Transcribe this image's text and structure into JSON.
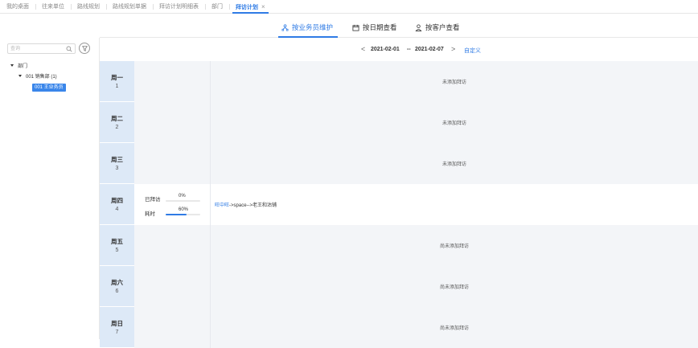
{
  "top_tabs": [
    {
      "label": "我的桌面"
    },
    {
      "label": "往来单位"
    },
    {
      "label": "路线规划"
    },
    {
      "label": "路线规划单据"
    },
    {
      "label": "拜访计划明细表"
    },
    {
      "label": "部门"
    },
    {
      "label": "拜访计划",
      "active": true,
      "close": "×"
    }
  ],
  "sidebar": {
    "search_placeholder": "查询",
    "tree": {
      "root": "部门",
      "child": "001 销售部 (1)",
      "leaf": "001 王业务员"
    }
  },
  "view_tabs": {
    "by_salesman": "按业务员维护",
    "by_date": "按日期查看",
    "by_customer": "按客户查看"
  },
  "date_range": {
    "prev": "<",
    "start": "2021-02-01",
    "sep": "--",
    "end": "2021-02-07",
    "next": ">",
    "custom": "自定义"
  },
  "days": [
    {
      "name": "周一",
      "num": "1",
      "content": "未添加拜访"
    },
    {
      "name": "周二",
      "num": "2",
      "content": "未添加拜访"
    },
    {
      "name": "周三",
      "num": "3",
      "content": "未添加拜访"
    },
    {
      "name": "周四",
      "num": "4",
      "stats": {
        "visited_label": "已拜访",
        "visited_pct": "0%",
        "visited_value": 0,
        "time_label": "耗时",
        "time_pct": "60%",
        "time_value": 60
      },
      "visit": {
        "link": "旺中旺",
        "rest": "->space-->老王和沽铺"
      }
    },
    {
      "name": "周五",
      "num": "5",
      "content": "尚未添加拜访"
    },
    {
      "name": "周六",
      "num": "6",
      "content": "尚未添加拜访"
    },
    {
      "name": "周日",
      "num": "7",
      "content": "尚未添加拜访"
    }
  ],
  "colors": {
    "accent": "#2f7be5",
    "day_label_bg": "#dde9f7"
  }
}
